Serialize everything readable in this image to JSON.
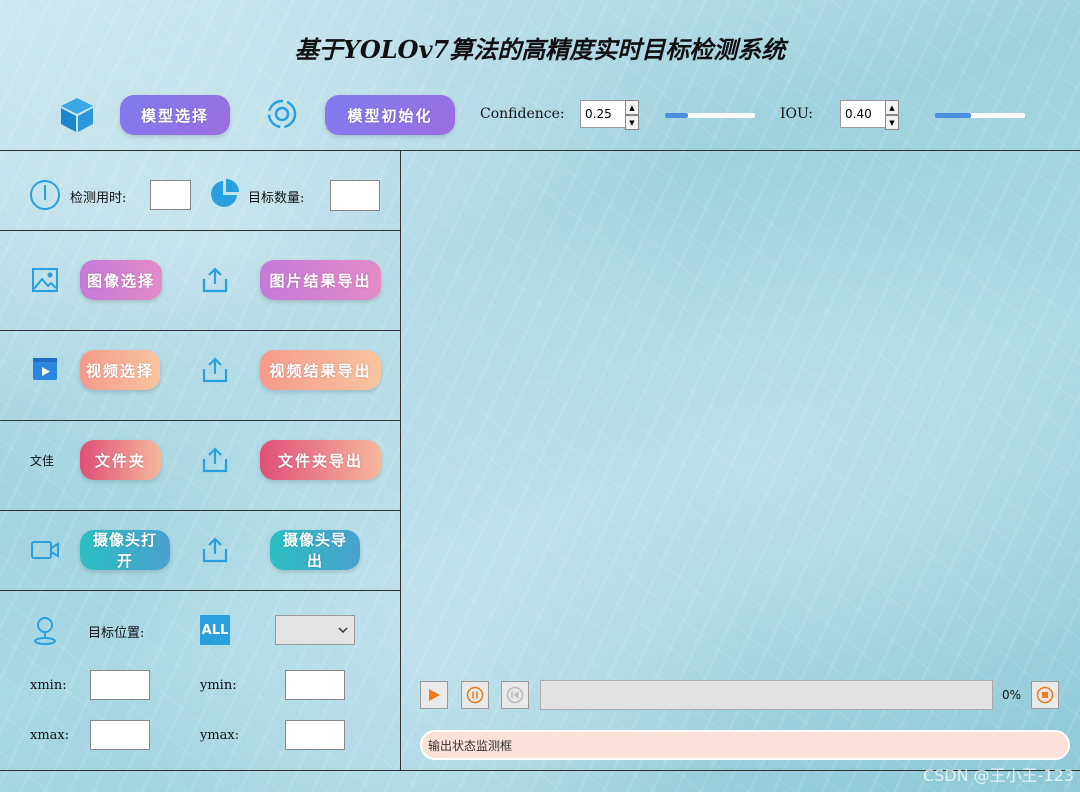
{
  "title": "基于YOLOv7算法的高精度实时目标检测系统",
  "toolbar": {
    "model_select": "模型选择",
    "model_init": "模型初始化",
    "confidence_label": "Confidence:",
    "confidence_value": "0.25",
    "confidence_slider": 0.25,
    "iou_label": "IOU:",
    "iou_value": "0.40",
    "iou_slider": 0.4
  },
  "stats": {
    "time_label": "检测用时:",
    "time_value": "",
    "count_label": "目标数量:",
    "count_value": ""
  },
  "image_row": {
    "select": "图像选择",
    "export": "图片结果导出"
  },
  "video_row": {
    "select": "视频选择",
    "export": "视频结果导出"
  },
  "folder_row": {
    "label": "文佳",
    "select": "文件夹",
    "export": "文件夹导出"
  },
  "camera_row": {
    "open": "摄像头打开",
    "export": "摄像头导出"
  },
  "position": {
    "label": "目标位置:",
    "all_icon_text": "ALL",
    "select_value": "",
    "xmin_label": "xmin:",
    "ymin_label": "ymin:",
    "xmax_label": "xmax:",
    "ymax_label": "ymax:",
    "xmin": "",
    "ymin": "",
    "xmax": "",
    "ymax": ""
  },
  "player": {
    "progress": 0,
    "progress_label": "0%"
  },
  "status": {
    "placeholder": "输出状态监测框"
  },
  "watermark": "CSDN @王小王-123",
  "colors": {
    "accent_blue": "#2a9fe0",
    "slider_fill": "#4a8fe0",
    "status_bg": "#fde1d8"
  }
}
